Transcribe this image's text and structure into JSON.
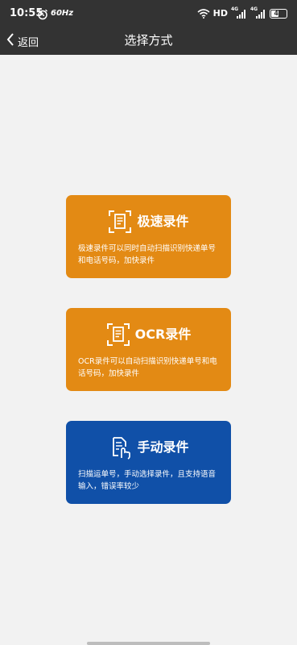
{
  "status_bar": {
    "time": "10:55",
    "refresh_rate": "60Hz",
    "network_label": "HD",
    "signal_1": "4G",
    "signal_2": "4G",
    "battery_level": "47"
  },
  "navbar": {
    "back_label": "返回",
    "title": "选择方式"
  },
  "options": [
    {
      "title": "极速录件",
      "description": "极速录件可以同时自动扫描识别快递单号和电话号码，加快录件",
      "color": "#e38a14",
      "icon": "scan-document-icon"
    },
    {
      "title": "OCR录件",
      "description": "OCR录件可以自动扫描识别快递单号和电话号码，加快录件",
      "color": "#e38a14",
      "icon": "scan-document-icon"
    },
    {
      "title": "手动录件",
      "description": "扫描运单号，手动选择录件，且支持语音输入，错误率较少",
      "color": "#1050a8",
      "icon": "manual-entry-hand-icon"
    }
  ],
  "colors": {
    "topbar": "#333333",
    "background": "#f2f2f2"
  }
}
